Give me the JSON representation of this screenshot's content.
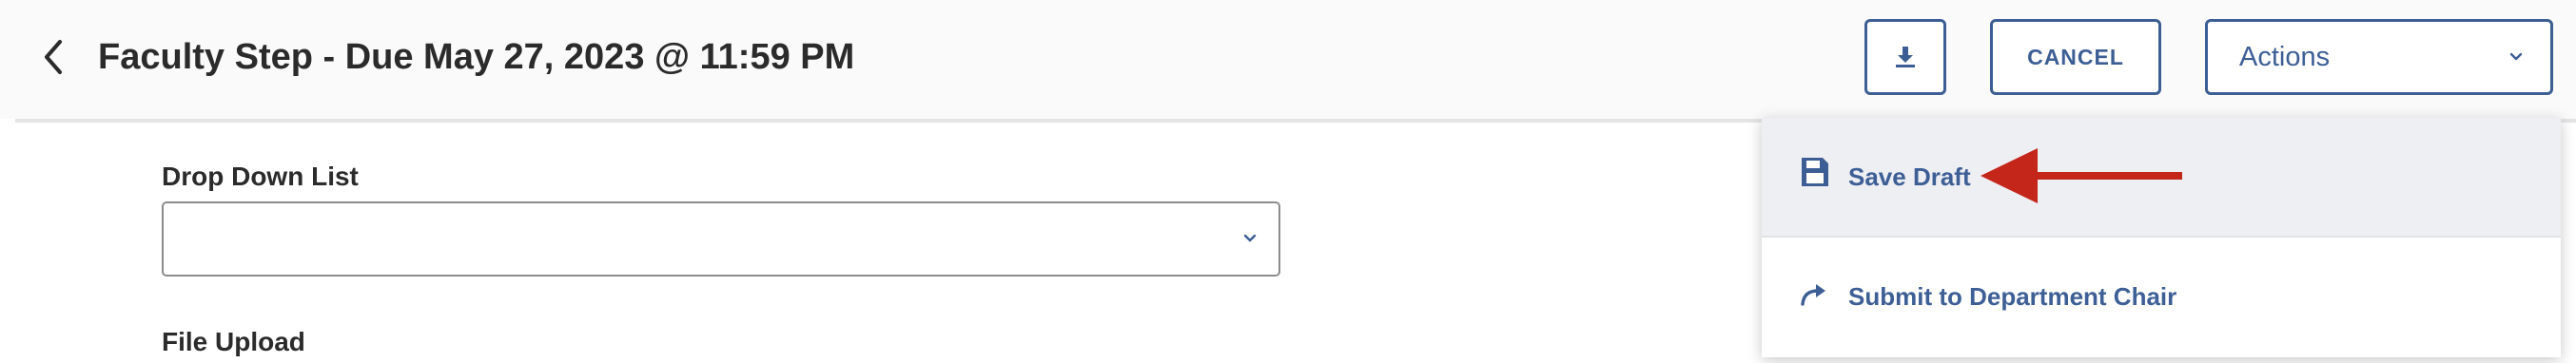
{
  "header": {
    "title": "Faculty Step - Due May 27, 2023 @ 11:59 PM",
    "back_icon": "chevron-left-icon",
    "download_icon": "download-icon",
    "cancel_label": "CANCEL",
    "actions_label": "Actions"
  },
  "form": {
    "dropdown_label": "Drop Down List",
    "dropdown_value": "",
    "file_upload_label": "File Upload"
  },
  "actions_menu": {
    "items": [
      {
        "label": "Save Draft",
        "icon": "floppy-disk-icon"
      },
      {
        "label": "Submit to Department Chair",
        "icon": "share-arrow-icon"
      }
    ]
  },
  "colors": {
    "accent": "#3c5e95",
    "annotation_arrow": "#c4261a"
  }
}
